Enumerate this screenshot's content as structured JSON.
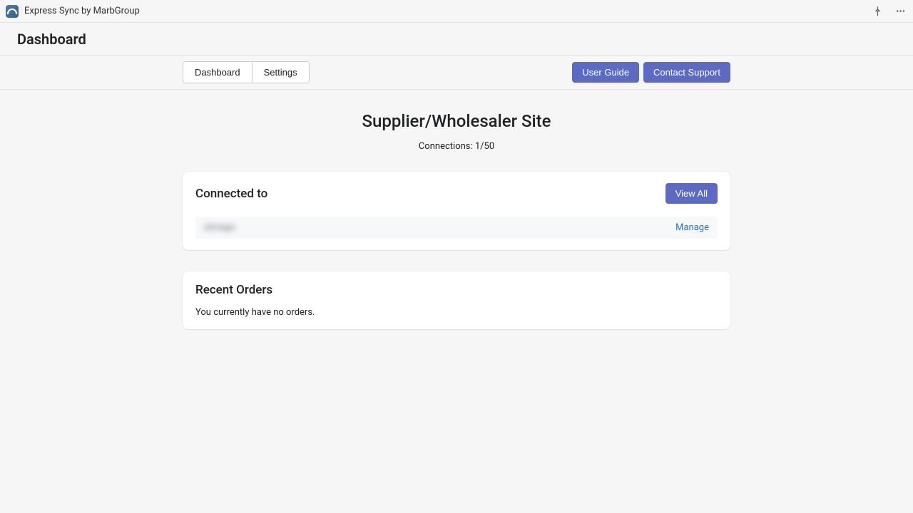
{
  "topbar": {
    "app_name": "Express Sync by MarbGroup"
  },
  "header": {
    "title": "Dashboard"
  },
  "nav": {
    "tabs": [
      "Dashboard",
      "Settings"
    ],
    "actions": {
      "user_guide": "User Guide",
      "contact_support": "Contact Support"
    }
  },
  "main": {
    "heading": "Supplier/Wholesaler Site",
    "connections_label": "Connections: 1/50"
  },
  "connected_card": {
    "title": "Connected to",
    "view_all": "View All",
    "rows": [
      {
        "name": "stmagn",
        "manage": "Manage"
      }
    ]
  },
  "orders_card": {
    "title": "Recent Orders",
    "empty": "You currently have no orders."
  }
}
